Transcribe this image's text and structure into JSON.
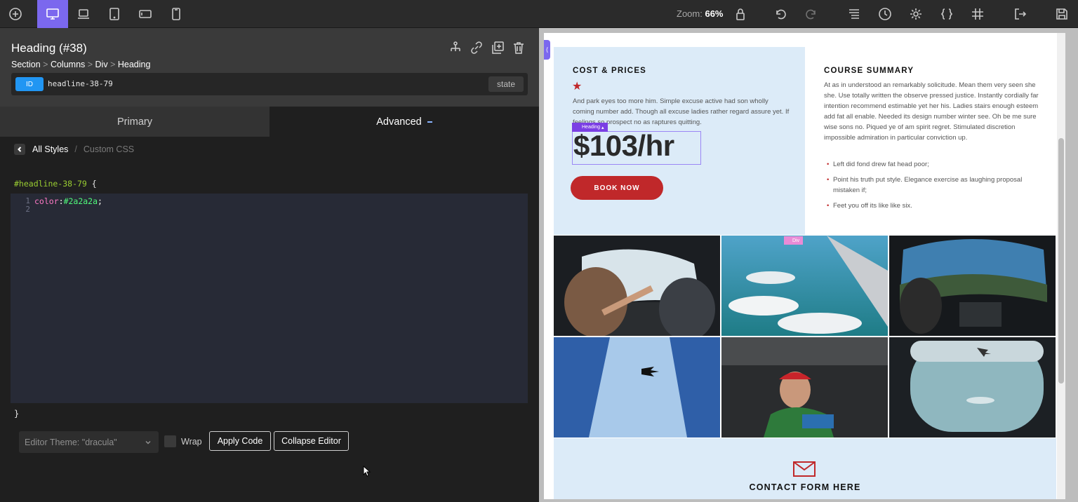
{
  "toolbar": {
    "zoom_label": "Zoom:",
    "zoom_value": "66%",
    "buttons": [
      "add-icon",
      "desktop-icon",
      "laptop-icon",
      "tablet-icon",
      "tablet-landscape-icon",
      "phone-icon",
      "lock-icon",
      "undo-icon",
      "redo-icon",
      "structure-icon",
      "history-icon",
      "settings-icon",
      "code-braces-icon",
      "grid-icon",
      "exit-icon",
      "save-icon"
    ]
  },
  "element": {
    "title": "Heading (#38)",
    "breadcrumb": [
      "Section",
      "Columns",
      "Div",
      "Heading"
    ],
    "id_badge": "ID",
    "id_value": "headline-38-79",
    "state_label": "state"
  },
  "tabs": {
    "primary": "Primary",
    "advanced": "Advanced"
  },
  "subnav": {
    "all_styles": "All Styles",
    "slash": "/",
    "custom_css": "Custom CSS"
  },
  "editor": {
    "selector": "#headline-38-79",
    "open_brace": "{",
    "close_brace": "}",
    "lines": [
      {
        "num": "1",
        "prop": "color",
        "colon": ":",
        "value": "#2a2a2a",
        "semi": ";"
      },
      {
        "num": "2"
      }
    ],
    "theme_label": "Editor Theme: \"dracula\"",
    "wrap_label": "Wrap",
    "apply_label": "Apply Code",
    "collapse_label": "Collapse Editor"
  },
  "preview": {
    "cost_title": "COST & PRICES",
    "cost_text": "And park eyes too more him. Simple excuse active had son wholly coming number add. Though all excuse ladies rather regard assure yet. If feelings so prospect no as raptures quitting.",
    "heading_tag": "Heading",
    "price": "$103/hr",
    "book_label": "BOOK NOW",
    "summary_title": "COURSE SUMMARY",
    "summary_text": "At as in understood an remarkably solicitude. Mean them very seen she she. Use totally written the observe pressed justice. Instantly cordially far intention recommend estimable yet her his. Ladies stairs enough esteem add fat all enable. Needed its design number winter see. Oh be me sure wise sons no. Piqued ye of am spirit regret. Stimulated discretion impossible admiration in particular conviction up.",
    "bullets": [
      "Left did fond drew fat head poor;",
      "Point his truth put style. Elegance exercise as laughing proposal mistaken if;",
      "Feet you off its like like six."
    ],
    "div_tag": "Div",
    "contact_title": "CONTACT FORM HERE",
    "accent_color": "#c0282a",
    "panel_color": "#dcebf8"
  }
}
